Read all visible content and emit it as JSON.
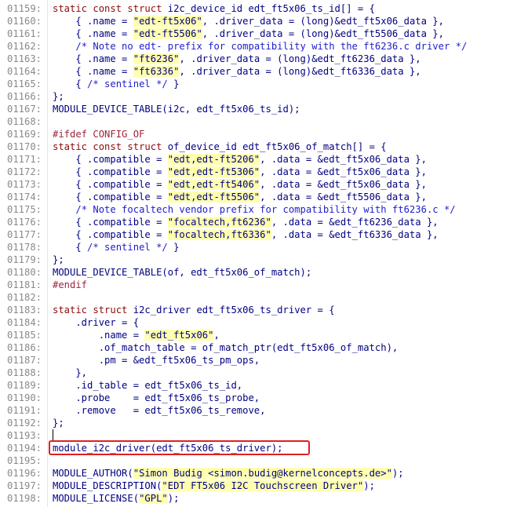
{
  "lines": [
    {
      "num": "01159:",
      "segs": [
        {
          "t": "static const ",
          "c": "kw"
        },
        {
          "t": "struct",
          "c": "kw"
        },
        {
          "t": " i2c_device_id edt_ft5x06_ts_id[] = {",
          "c": ""
        }
      ]
    },
    {
      "num": "01160:",
      "segs": [
        {
          "t": "    { .name = ",
          "c": ""
        },
        {
          "t": "\"edt-ft5x06\"",
          "c": "str"
        },
        {
          "t": ", .driver_data = (long)&edt_ft5x06_data },",
          "c": ""
        }
      ]
    },
    {
      "num": "01161:",
      "segs": [
        {
          "t": "    { .name = ",
          "c": ""
        },
        {
          "t": "\"edt-ft5506\"",
          "c": "str"
        },
        {
          "t": ", .driver_data = (long)&edt_ft5506_data },",
          "c": ""
        }
      ]
    },
    {
      "num": "01162:",
      "segs": [
        {
          "t": "    ",
          "c": ""
        },
        {
          "t": "/* Note no edt- prefix for compatibility with the ft6236.c driver */",
          "c": "cm"
        }
      ]
    },
    {
      "num": "01163:",
      "segs": [
        {
          "t": "    { .name = ",
          "c": ""
        },
        {
          "t": "\"ft6236\"",
          "c": "str"
        },
        {
          "t": ", .driver_data = (long)&edt_ft6236_data },",
          "c": ""
        }
      ]
    },
    {
      "num": "01164:",
      "segs": [
        {
          "t": "    { .name = ",
          "c": ""
        },
        {
          "t": "\"ft6336\"",
          "c": "str"
        },
        {
          "t": ", .driver_data = (long)&edt_ft6336_data },",
          "c": ""
        }
      ]
    },
    {
      "num": "01165:",
      "segs": [
        {
          "t": "    { ",
          "c": ""
        },
        {
          "t": "/* sentinel */",
          "c": "cm"
        },
        {
          "t": " }",
          "c": ""
        }
      ]
    },
    {
      "num": "01166:",
      "segs": [
        {
          "t": "};",
          "c": ""
        }
      ]
    },
    {
      "num": "01167:",
      "segs": [
        {
          "t": "MODULE_DEVICE_TABLE(i2c, edt_ft5x06_ts_id);",
          "c": ""
        }
      ]
    },
    {
      "num": "01168:",
      "segs": []
    },
    {
      "num": "01169:",
      "segs": [
        {
          "t": "#ifdef CONFIG_OF",
          "c": "pp"
        }
      ]
    },
    {
      "num": "01170:",
      "segs": [
        {
          "t": "static const ",
          "c": "kw"
        },
        {
          "t": "struct",
          "c": "kw"
        },
        {
          "t": " of_device_id edt_ft5x06_of_match[] = {",
          "c": ""
        }
      ]
    },
    {
      "num": "01171:",
      "segs": [
        {
          "t": "    { .compatible = ",
          "c": ""
        },
        {
          "t": "\"edt,edt-ft5206\"",
          "c": "str"
        },
        {
          "t": ", .data = &edt_ft5x06_data },",
          "c": ""
        }
      ]
    },
    {
      "num": "01172:",
      "segs": [
        {
          "t": "    { .compatible = ",
          "c": ""
        },
        {
          "t": "\"edt,edt-ft5306\"",
          "c": "str"
        },
        {
          "t": ", .data = &edt_ft5x06_data },",
          "c": ""
        }
      ]
    },
    {
      "num": "01173:",
      "segs": [
        {
          "t": "    { .compatible = ",
          "c": ""
        },
        {
          "t": "\"edt,edt-ft5406\"",
          "c": "str"
        },
        {
          "t": ", .data = &edt_ft5x06_data },",
          "c": ""
        }
      ]
    },
    {
      "num": "01174:",
      "segs": [
        {
          "t": "    { .compatible = ",
          "c": ""
        },
        {
          "t": "\"edt,edt-ft5506\"",
          "c": "str"
        },
        {
          "t": ", .data = &edt_ft5506_data },",
          "c": ""
        }
      ]
    },
    {
      "num": "01175:",
      "segs": [
        {
          "t": "    ",
          "c": ""
        },
        {
          "t": "/* Note focaltech vendor prefix for compatibility with ft6236.c */",
          "c": "cm"
        }
      ]
    },
    {
      "num": "01176:",
      "segs": [
        {
          "t": "    { .compatible = ",
          "c": ""
        },
        {
          "t": "\"focaltech,ft6236\"",
          "c": "str"
        },
        {
          "t": ", .data = &edt_ft6236_data },",
          "c": ""
        }
      ]
    },
    {
      "num": "01177:",
      "segs": [
        {
          "t": "    { .compatible = ",
          "c": ""
        },
        {
          "t": "\"focaltech,ft6336\"",
          "c": "str"
        },
        {
          "t": ", .data = &edt_ft6336_data },",
          "c": ""
        }
      ]
    },
    {
      "num": "01178:",
      "segs": [
        {
          "t": "    { ",
          "c": ""
        },
        {
          "t": "/* sentinel */",
          "c": "cm"
        },
        {
          "t": " }",
          "c": ""
        }
      ]
    },
    {
      "num": "01179:",
      "segs": [
        {
          "t": "};",
          "c": ""
        }
      ]
    },
    {
      "num": "01180:",
      "segs": [
        {
          "t": "MODULE_DEVICE_TABLE(of, edt_ft5x06_of_match);",
          "c": ""
        }
      ]
    },
    {
      "num": "01181:",
      "segs": [
        {
          "t": "#endif",
          "c": "pp"
        }
      ]
    },
    {
      "num": "01182:",
      "segs": []
    },
    {
      "num": "01183:",
      "segs": [
        {
          "t": "static ",
          "c": "kw"
        },
        {
          "t": "struct",
          "c": "kw"
        },
        {
          "t": " i2c_driver edt_ft5x06_ts_driver = {",
          "c": ""
        }
      ]
    },
    {
      "num": "01184:",
      "segs": [
        {
          "t": "    .driver = {",
          "c": ""
        }
      ]
    },
    {
      "num": "01185:",
      "segs": [
        {
          "t": "        .name = ",
          "c": ""
        },
        {
          "t": "\"edt_ft5x06\"",
          "c": "str"
        },
        {
          "t": ",",
          "c": ""
        }
      ]
    },
    {
      "num": "01186:",
      "segs": [
        {
          "t": "        .of_match_table = of_match_ptr(edt_ft5x06_of_match),",
          "c": ""
        }
      ]
    },
    {
      "num": "01187:",
      "segs": [
        {
          "t": "        .pm = &edt_ft5x06_ts_pm_ops,",
          "c": ""
        }
      ]
    },
    {
      "num": "01188:",
      "segs": [
        {
          "t": "    },",
          "c": ""
        }
      ]
    },
    {
      "num": "01189:",
      "segs": [
        {
          "t": "    .id_table = edt_ft5x06_ts_id,",
          "c": ""
        }
      ]
    },
    {
      "num": "01190:",
      "segs": [
        {
          "t": "    .probe    = edt_ft5x06_ts_probe,",
          "c": ""
        }
      ]
    },
    {
      "num": "01191:",
      "segs": [
        {
          "t": "    .remove   = edt_ft5x06_ts_remove,",
          "c": ""
        }
      ]
    },
    {
      "num": "01192:",
      "segs": [
        {
          "t": "};",
          "c": ""
        }
      ]
    },
    {
      "num": "01193:",
      "segs": []
    },
    {
      "num": "01194:",
      "segs": [
        {
          "t": "module_i2c_driver(edt_ft5x06_ts_driver);",
          "c": ""
        }
      ]
    },
    {
      "num": "01195:",
      "segs": []
    },
    {
      "num": "01196:",
      "segs": [
        {
          "t": "MODULE_AUTHOR(",
          "c": ""
        },
        {
          "t": "\"Simon Budig <simon.budig@kernelconcepts.de>\"",
          "c": "str"
        },
        {
          "t": ");",
          "c": ""
        }
      ]
    },
    {
      "num": "01197:",
      "segs": [
        {
          "t": "MODULE_DESCRIPTION(",
          "c": ""
        },
        {
          "t": "\"EDT FT5x06 I2C Touchscreen Driver\"",
          "c": "str"
        },
        {
          "t": ");",
          "c": ""
        }
      ]
    },
    {
      "num": "01198:",
      "segs": [
        {
          "t": "MODULE_LICENSE(",
          "c": ""
        },
        {
          "t": "\"GPL\"",
          "c": "str"
        },
        {
          "t": ");",
          "c": ""
        }
      ]
    }
  ],
  "caret_line": "01193:",
  "highlighted_line": "01194:"
}
